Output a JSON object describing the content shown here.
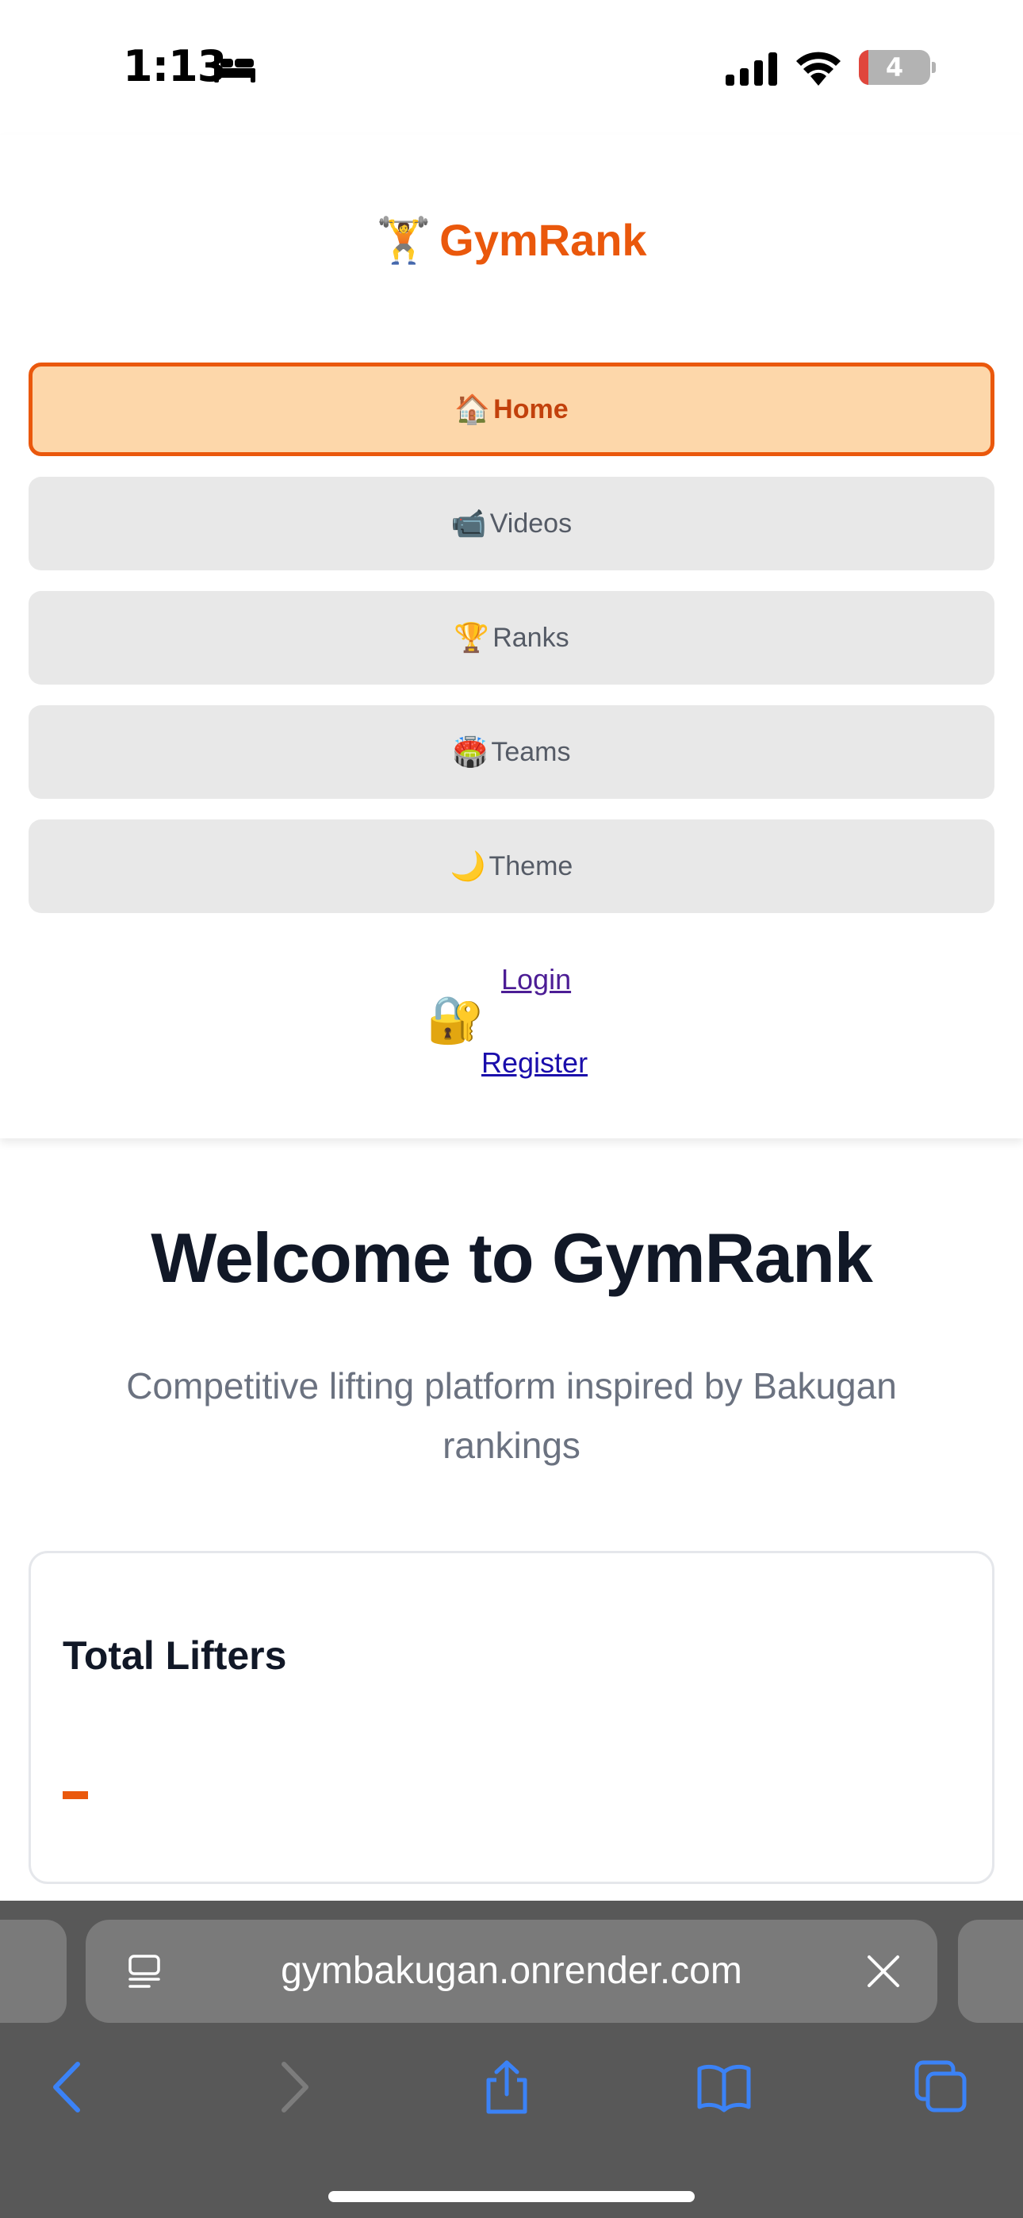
{
  "status_bar": {
    "time": "1:13",
    "battery_level": "4",
    "icons": [
      "bed-icon",
      "cellular-signal-icon",
      "wifi-icon",
      "battery-icon"
    ]
  },
  "header": {
    "brand_emoji": "🏋️",
    "brand_name": "GymRank",
    "brand_color": "#ea580c",
    "nav": [
      {
        "emoji": "🏠",
        "label": "Home",
        "active": true
      },
      {
        "emoji": "📹",
        "label": "Videos",
        "active": false
      },
      {
        "emoji": "🏆",
        "label": "Ranks",
        "active": false
      },
      {
        "emoji": "🏟️",
        "label": "Teams",
        "active": false
      },
      {
        "emoji": "🌙",
        "label": "Theme",
        "active": false
      }
    ],
    "auth": {
      "icon": "🔐",
      "login_label": "Login",
      "register_label": "Register"
    }
  },
  "main": {
    "title": "Welcome to GymRank",
    "subtitle": "Competitive lifting platform inspired by Bakugan rankings",
    "stats": [
      {
        "label": "Total Lifters",
        "value": "-"
      }
    ]
  },
  "browser": {
    "url": "gymbakugan.onrender.com",
    "toolbar": [
      "back-icon",
      "forward-icon",
      "share-icon",
      "bookmarks-icon",
      "tabs-icon"
    ],
    "accent_color": "#3b82f6"
  }
}
